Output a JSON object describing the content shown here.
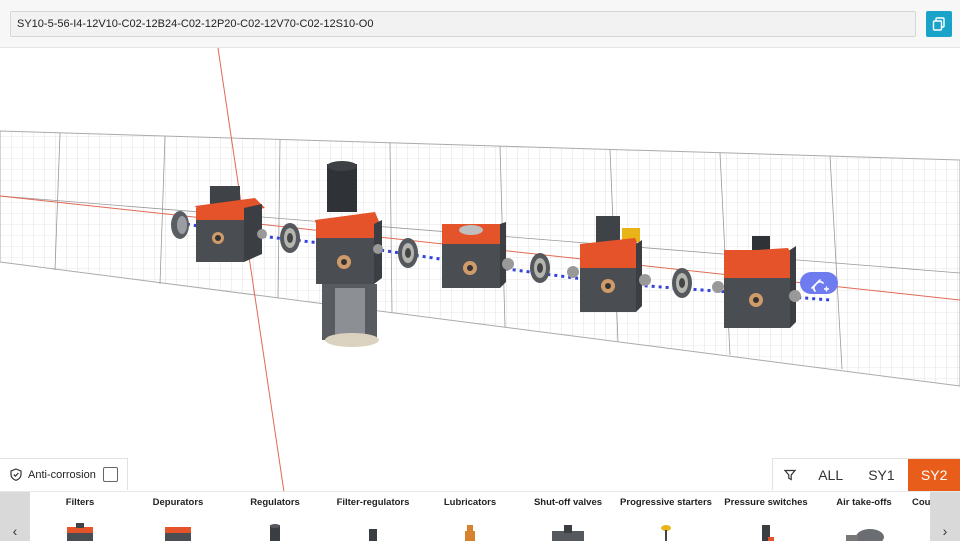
{
  "config": {
    "code": "SY10-5-56-I4-12V10-C02-12B24-C02-12P20-C02-12V70-C02-12S10-O0"
  },
  "anti_corrosion": {
    "label": "Anti-corrosion",
    "checked": false
  },
  "filters": {
    "all_label": "ALL",
    "sy1_label": "SY1",
    "sy2_label": "SY2",
    "active": "SY2"
  },
  "categories": [
    {
      "label": "Filters"
    },
    {
      "label": "Depurators"
    },
    {
      "label": "Regulators"
    },
    {
      "label": "Filter-regulators"
    },
    {
      "label": "Lubricators"
    },
    {
      "label": "Shut-off valves"
    },
    {
      "label": "Progressive starters"
    },
    {
      "label": "Pressure switches"
    },
    {
      "label": "Air take-offs"
    },
    {
      "label": "Cou"
    }
  ],
  "colors": {
    "accent_orange": "#e85d1a",
    "copy_button": "#1aa3c8",
    "module_orange": "#e4532a",
    "module_grey": "#4a4d52",
    "link_badge": "#6f7cf0"
  },
  "icons": {
    "copy": "copy-icon",
    "shield": "shield-icon",
    "funnel": "funnel-icon",
    "link": "link-icon",
    "arrow_left": "chevron-left-icon",
    "arrow_right": "chevron-right-icon"
  }
}
